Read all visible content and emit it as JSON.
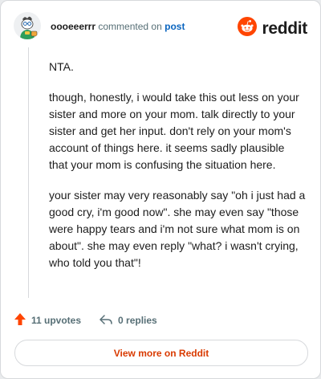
{
  "header": {
    "username": "oooeeerrr",
    "commented_on": "commented on",
    "post_link": "post",
    "brand_name": "reddit"
  },
  "comment": {
    "paragraphs": [
      "NTA.",
      "though, honestly, i would take this out less on your sister and more on your mom. talk directly to your sister and get her input. don't rely on your mom's account of things here. it seems sadly plausible that your mom is confusing the situation here.",
      "your sister may very reasonably say \"oh i just had a good cry, i'm good now\". she may even say \"those were happy tears and i'm not sure what mom is on about\". she may even reply \"what? i wasn't crying, who told you that\"!"
    ]
  },
  "actions": {
    "upvotes": "11 upvotes",
    "replies": "0 replies"
  },
  "footer": {
    "view_more": "View more on Reddit"
  },
  "colors": {
    "brand": "#ff4500",
    "link": "#0a65bf",
    "cta": "#d93a00",
    "muted": "#576f76"
  },
  "icons": {
    "brand": "reddit-snoo-icon",
    "upvote": "upvote-arrow-icon",
    "reply": "reply-arrow-icon",
    "avatar": "user-avatar"
  }
}
